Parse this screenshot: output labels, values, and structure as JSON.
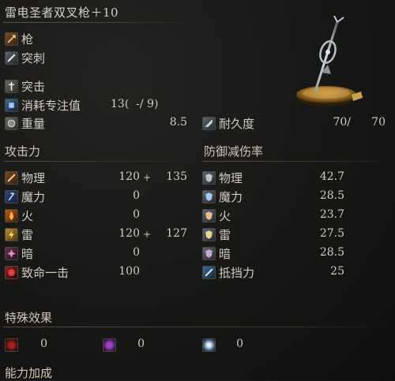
{
  "weapon": {
    "name": "雷电圣者双叉枪＋10",
    "type": "枪",
    "attack_type_1": "突刺",
    "skill": "突击",
    "fp_label": "消耗专注值",
    "fp_value": "13(  -/ 9)",
    "weight_label": "重量",
    "weight_value": "8.5",
    "durability_label": "耐久度",
    "durability_current": "70/",
    "durability_max": "70"
  },
  "attack": {
    "title": "攻击力",
    "rows": [
      {
        "label": "物理",
        "base": "120",
        "plus": "+",
        "bonus": "135",
        "icon": "physical-icon"
      },
      {
        "label": "魔力",
        "base": "0",
        "plus": "",
        "bonus": "",
        "icon": "magic-icon"
      },
      {
        "label": "火",
        "base": "0",
        "plus": "",
        "bonus": "",
        "icon": "fire-icon"
      },
      {
        "label": "雷",
        "base": "120",
        "plus": "+",
        "bonus": "127",
        "icon": "lightning-icon"
      },
      {
        "label": "暗",
        "base": "0",
        "plus": "",
        "bonus": "",
        "icon": "dark-icon"
      },
      {
        "label": "致命一击",
        "base": "100",
        "plus": "",
        "bonus": "",
        "icon": "critical-icon"
      }
    ]
  },
  "defense": {
    "title": "防御减伤率",
    "rows": [
      {
        "label": "物理",
        "value": "42.7"
      },
      {
        "label": "魔力",
        "value": "28.5"
      },
      {
        "label": "火",
        "value": "23.7"
      },
      {
        "label": "雷",
        "value": "27.5"
      },
      {
        "label": "暗",
        "value": "28.5"
      },
      {
        "label": "抵挡力",
        "value": "25"
      }
    ]
  },
  "effects": {
    "title": "特殊效果",
    "items": [
      {
        "icon": "bleed-icon",
        "value": "0"
      },
      {
        "icon": "poison-icon",
        "value": "0"
      },
      {
        "icon": "frost-icon",
        "value": "0"
      }
    ]
  },
  "scaling": {
    "title": "能力加成"
  }
}
